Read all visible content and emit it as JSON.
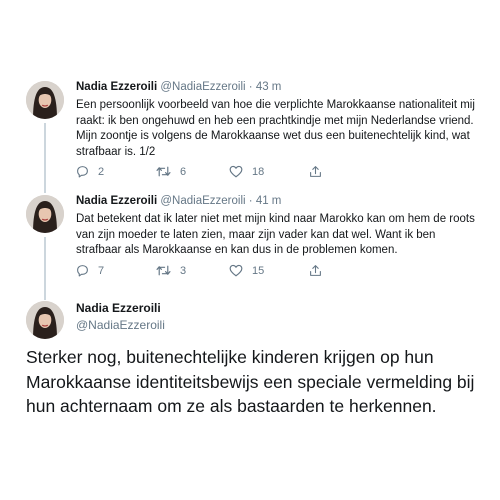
{
  "author": {
    "name": "Nadia Ezzeroili",
    "handle": "@NadiaEzzeroili"
  },
  "tweets": [
    {
      "time": "43 m",
      "text": "Een persoonlijk voorbeeld van hoe die verplichte Marokkaanse nationaliteit mij raakt: ik ben ongehuwd en heb een prachtkindje met mijn Nederlandse vriend. Mijn zoontje is volgens de Marokkaanse wet dus een buitenechtelijk kind, wat strafbaar is. 1/2",
      "replies": "2",
      "retweets": "6",
      "likes": "18"
    },
    {
      "time": "41 m",
      "text": "Dat betekent dat ik later niet met mijn kind naar Marokko kan om hem de roots van zijn moeder te laten zien, maar zijn vader kan dat wel. Want ik ben strafbaar als Marokkaanse en kan dus in de problemen komen.",
      "replies": "7",
      "retweets": "3",
      "likes": "15"
    },
    {
      "text": "Sterker nog, buitenechtelijke kinderen krijgen op hun Marokkaanse identiteitsbewijs een speciale vermelding bij hun achternaam om ze als bastaarden te herkennen."
    }
  ],
  "separator": "·",
  "icons": [
    "reply-icon",
    "retweet-icon",
    "like-icon",
    "share-icon"
  ],
  "colors": {
    "text": "#14171a",
    "muted": "#657786",
    "thread_line": "#ccd6dd"
  }
}
